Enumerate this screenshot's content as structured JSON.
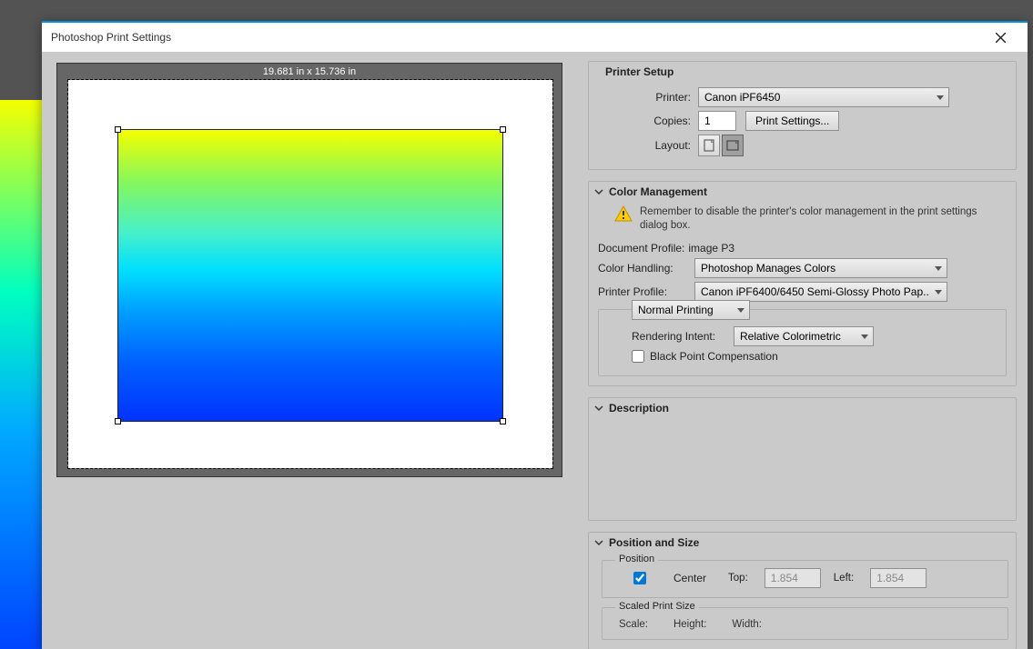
{
  "dialog": {
    "title": "Photoshop Print Settings"
  },
  "preview": {
    "dimensions": "19.681 in x 15.736 in"
  },
  "printerSetup": {
    "title": "Printer Setup",
    "printerLabel": "Printer:",
    "printer": "Canon iPF6450",
    "copiesLabel": "Copies:",
    "copies": "1",
    "printSettingsBtn": "Print Settings...",
    "layoutLabel": "Layout:"
  },
  "colorMgmt": {
    "title": "Color Management",
    "warning": "Remember to disable the printer's color management in the print settings dialog box.",
    "docProfileLabel": "Document Profile:",
    "docProfile": "image P3",
    "colorHandlingLabel": "Color Handling:",
    "colorHandling": "Photoshop Manages Colors",
    "printerProfileLabel": "Printer Profile:",
    "printerProfile": "Canon iPF6400/6450 Semi-Glossy Photo Pap...",
    "mode": "Normal Printing",
    "renderingIntentLabel": "Rendering Intent:",
    "renderingIntent": "Relative Colorimetric",
    "blackPointLabel": "Black Point Compensation",
    "blackPointChecked": false
  },
  "description": {
    "title": "Description"
  },
  "positionSize": {
    "title": "Position and Size",
    "positionLegend": "Position",
    "centerLabel": "Center",
    "centerChecked": true,
    "topLabel": "Top:",
    "top": "1.854",
    "leftLabel": "Left:",
    "left": "1.854",
    "scaledLegend": "Scaled Print Size",
    "scaleLabel": "Scale:",
    "heightLabel": "Height:",
    "widthLabel": "Width:"
  }
}
